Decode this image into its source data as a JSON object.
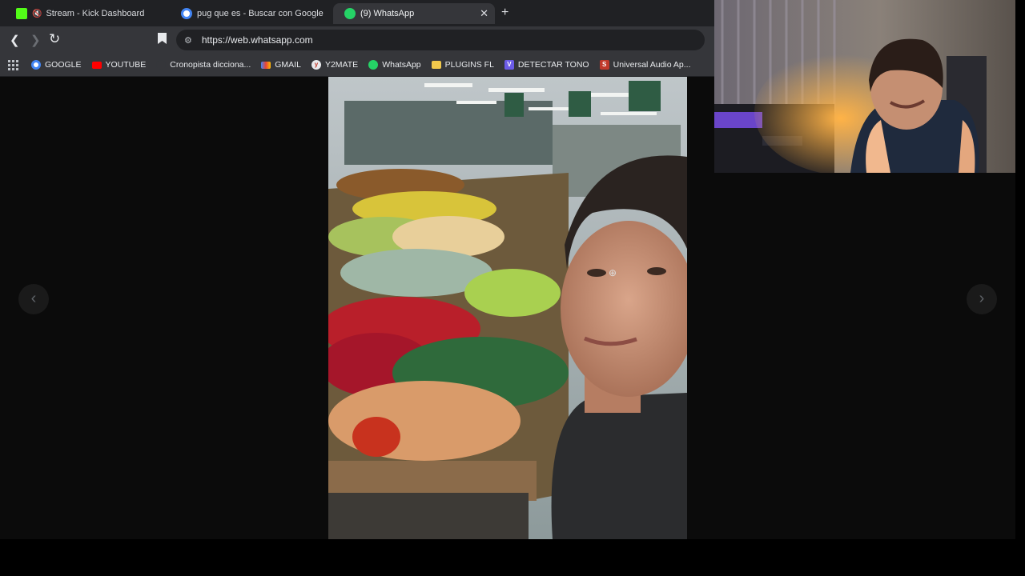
{
  "tabs": [
    {
      "title": "Stream - Kick Dashboard",
      "icon": "kick-icon",
      "muted": true
    },
    {
      "title": "pug que es - Buscar con Google",
      "icon": "google-icon"
    },
    {
      "title": "(9) WhatsApp",
      "icon": "whatsapp-icon",
      "active": true
    }
  ],
  "toolbar": {
    "url": "https://web.whatsapp.com"
  },
  "bookmarks": [
    {
      "label": "GOOGLE",
      "icon": "google-icon",
      "color": "#4285f4"
    },
    {
      "label": "YOUTUBE",
      "icon": "youtube-icon",
      "color": "#ff0000"
    },
    {
      "label": "Cronopista dicciona...",
      "icon": "cronopista-icon",
      "color": "#35363a"
    },
    {
      "label": "GMAIL",
      "icon": "gmail-icon",
      "color": "#ea4335"
    },
    {
      "label": "Y2MATE",
      "icon": "y2mate-icon",
      "color": "#e8eaed"
    },
    {
      "label": "WhatsApp",
      "icon": "whatsapp-icon",
      "color": "#25d366"
    },
    {
      "label": "PLUGINS FL",
      "icon": "folder-icon",
      "color": "#f2c94c"
    },
    {
      "label": "DETECTAR TONO",
      "icon": "detectar-icon",
      "color": "#6c5ce7"
    },
    {
      "label": "Universal Audio Ap...",
      "icon": "universal-audio-icon",
      "color": "#c0392b"
    }
  ],
  "viewer": {
    "prev_icon": "chevron-left-icon",
    "next_icon": "chevron-right-icon"
  },
  "colors": {
    "tabstrip": "#202124",
    "toolbar": "#35363a",
    "viewer_bg": "#0b0b0b",
    "kick_green": "#53fc18",
    "whatsapp_green": "#25d366"
  }
}
